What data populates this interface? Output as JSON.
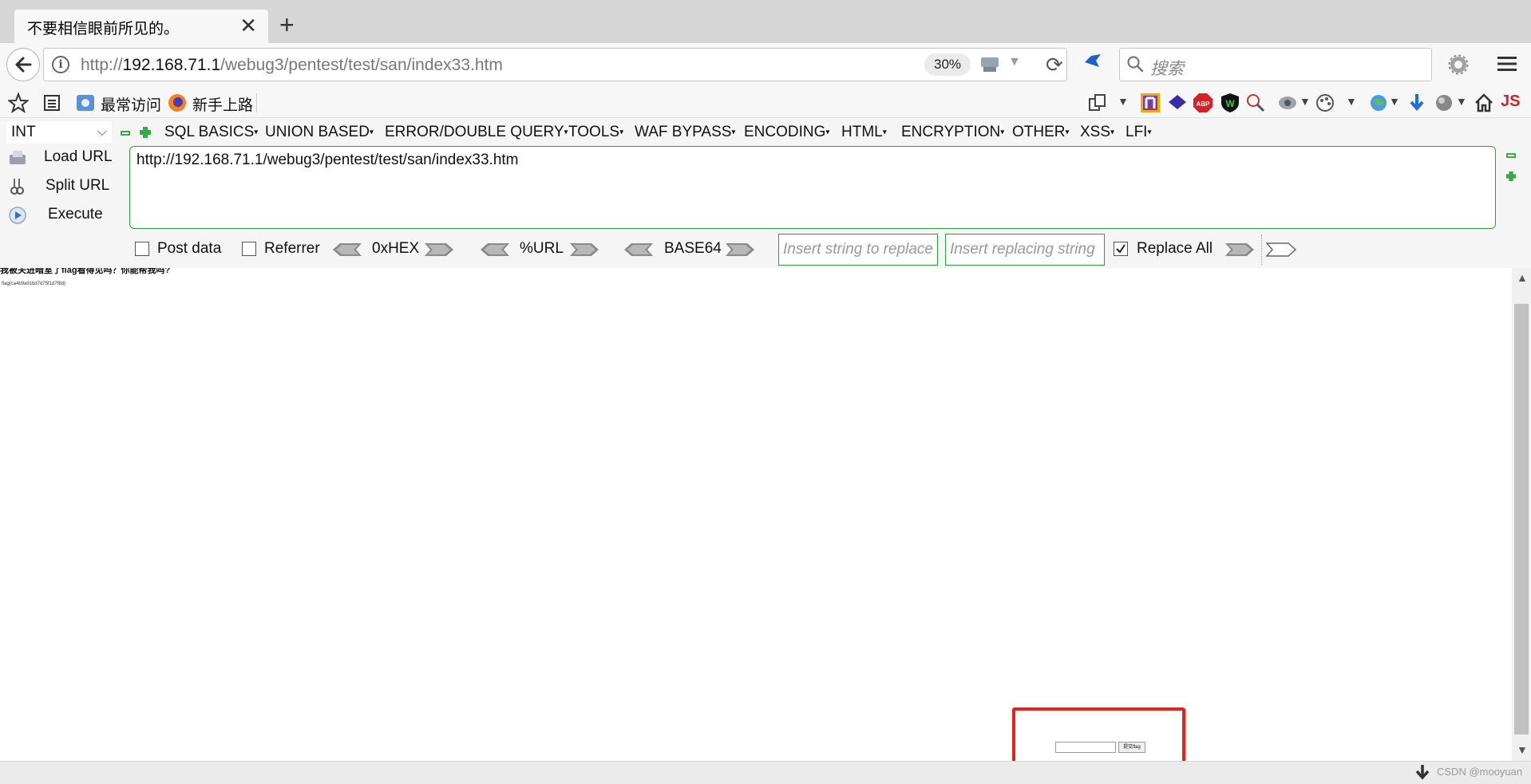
{
  "tab": {
    "title": "不要相信眼前所见的。",
    "close": "✕",
    "new_tab": "+"
  },
  "nav": {
    "url_prefix": "http://",
    "url_host": "192.168.71.1",
    "url_path": "/webug3/pentest/test/san/index33.htm",
    "zoom": "30%",
    "search_placeholder": "搜索"
  },
  "bookmarks": {
    "most_visited": "最常访问",
    "getting_started": "新手上路"
  },
  "hackbar": {
    "select_value": "INT",
    "menus": [
      "SQL BASICS",
      "UNION BASED",
      "ERROR/DOUBLE QUERY",
      "TOOLS",
      "WAF BYPASS",
      "ENCODING",
      "HTML",
      "ENCRYPTION",
      "OTHER",
      "XSS",
      "LFI"
    ],
    "load_url": "Load URL",
    "split_url": "Split URL",
    "execute": "Execute",
    "url_value": "http://192.168.71.1/webug3/pentest/test/san/index33.htm",
    "post_data": "Post data",
    "referrer": "Referrer",
    "hex": "0xHEX",
    "url_enc": "%URL",
    "base64": "BASE64",
    "replace_placeholder": "Insert string to replace",
    "replacing_placeholder": "Insert replacing string",
    "replace_all": "Replace All",
    "post_data_checked": false,
    "referrer_checked": false,
    "replace_all_checked": true
  },
  "page": {
    "line1": "我被关进暗室了flag看得见吗？你能帮我吗?",
    "line2": "flag{ca4b9a91bd7d75f1d7f8d}",
    "submit_label": "提交flag"
  },
  "status": {
    "watermark": "CSDN @mooyuan"
  },
  "colors": {
    "hackbar_border": "#2e9e3a",
    "highlight": "#e8221b"
  }
}
